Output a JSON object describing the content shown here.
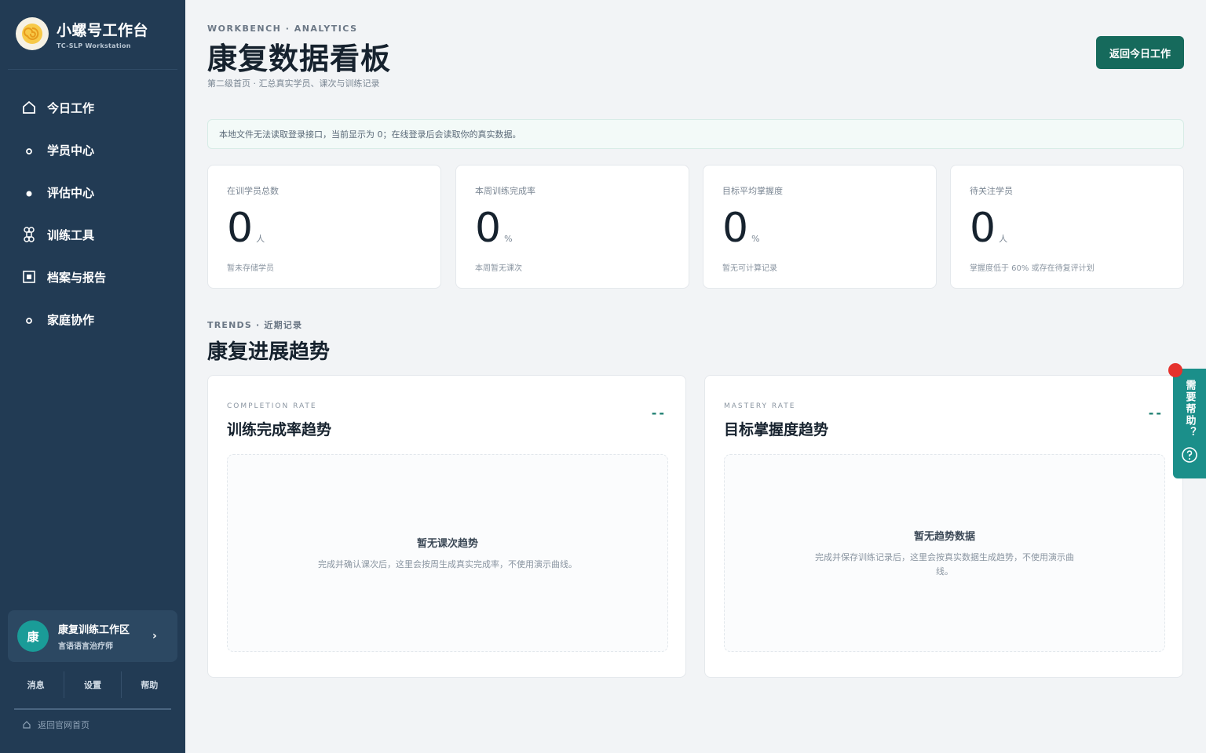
{
  "brand": {
    "title": "小螺号工作台",
    "subtitle": "TC-SLP Workstation"
  },
  "sidebar": {
    "items": [
      {
        "label": "今日工作",
        "icon": "home-icon"
      },
      {
        "label": "学员中心",
        "icon": "dot-icon"
      },
      {
        "label": "评估中心",
        "icon": "dot-icon"
      },
      {
        "label": "训练工具",
        "icon": "command-icon"
      },
      {
        "label": "档案与报告",
        "icon": "report-icon"
      },
      {
        "label": "家庭协作",
        "icon": "dot-icon"
      }
    ],
    "workspace": {
      "avatar": "康",
      "title": "康复训练工作区",
      "subtitle": "言语语言治疗师"
    },
    "actions": [
      "消息",
      "设置",
      "帮助"
    ],
    "back_label": "返回官网首页"
  },
  "header": {
    "eyebrow": "WORKBENCH · ANALYTICS",
    "title": "康复数据看板",
    "subtitle": "第二级首页 · 汇总真实学员、课次与训练记录",
    "back_button": "返回今日工作"
  },
  "notice": "本地文件无法读取登录接口，当前显示为 0；在线登录后会读取你的真实数据。",
  "stats": [
    {
      "label": "在训学员总数",
      "value": "0",
      "unit": "人",
      "note": "暂未存储学员"
    },
    {
      "label": "本周训练完成率",
      "value": "0",
      "unit": "%",
      "note": "本周暂无课次"
    },
    {
      "label": "目标平均掌握度",
      "value": "0",
      "unit": "%",
      "note": "暂无可计算记录"
    },
    {
      "label": "待关注学员",
      "value": "0",
      "unit": "人",
      "note": "掌握度低于 60% 或存在待复评计划"
    }
  ],
  "section": {
    "eyebrow": "TRENDS · 近期记录",
    "title": "康复进展趋势"
  },
  "trends": [
    {
      "eyebrow": "COMPLETION RATE",
      "title": "训练完成率趋势",
      "dash": "--",
      "empty_title": "暂无课次趋势",
      "empty_desc": "完成并确认课次后，这里会按周生成真实完成率，不使用演示曲线。"
    },
    {
      "eyebrow": "MASTERY RATE",
      "title": "目标掌握度趋势",
      "dash": "--",
      "empty_title": "暂无趋势数据",
      "empty_desc": "完成并保存训练记录后，这里会按真实数据生成趋势，不使用演示曲线。"
    }
  ],
  "help": {
    "label": "需要帮助？"
  },
  "colors": {
    "sidebar_bg": "#223b54",
    "primary": "#166a5c",
    "accent": "#1b8f8a",
    "alert_dot": "#e5322d"
  }
}
